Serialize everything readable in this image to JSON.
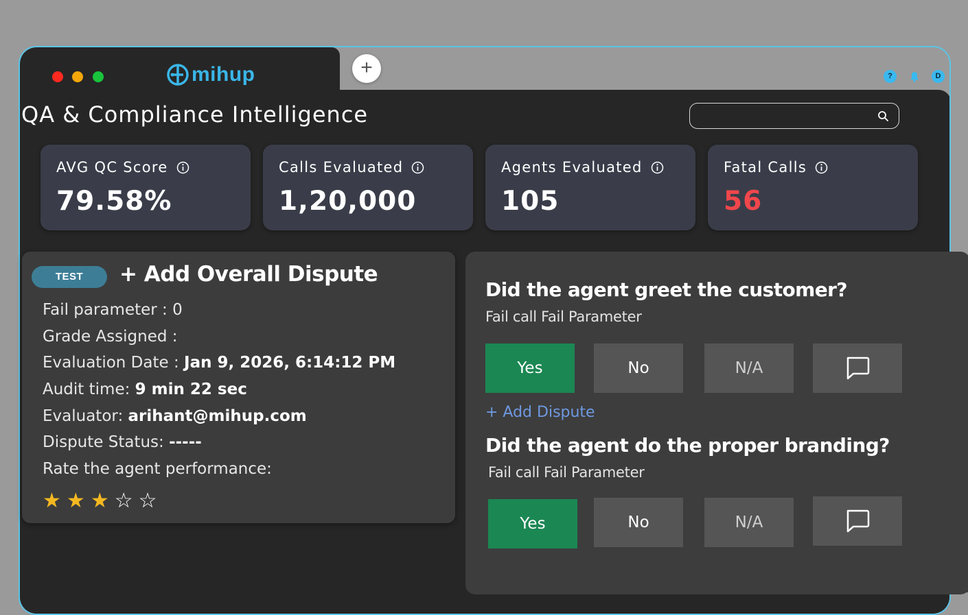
{
  "browser": {
    "brand": "mihup",
    "new_tab": "+"
  },
  "header": {
    "help": "?",
    "avatar": "D",
    "title": "QA & Compliance Intelligence",
    "search_placeholder": ""
  },
  "kpis": [
    {
      "label": "AVG QC Score",
      "value": "79.58%"
    },
    {
      "label": "Calls Evaluated",
      "value": "1,20,000"
    },
    {
      "label": "Agents Evaluated",
      "value": "105"
    },
    {
      "label": "Fatal Calls",
      "value": "56",
      "color": "#f0474c"
    }
  ],
  "evaluation": {
    "badge": "TEST",
    "add_overall": "+ Add Overall Dispute",
    "rows": [
      {
        "label": "Fail parameter : 0",
        "value": ""
      },
      {
        "label": "Grade Assigned :",
        "value": ""
      },
      {
        "label": "Evaluation Date : ",
        "value": "Jan 9, 2026, 6:14:12 PM"
      },
      {
        "label": "Audit time: ",
        "value": "9 min 22 sec"
      },
      {
        "label": "Evaluator: ",
        "value": "arihant@mihup.com"
      },
      {
        "label": "Dispute Status: ",
        "value": "-----"
      },
      {
        "label": "Rate the agent performance:",
        "value": ""
      }
    ],
    "rating": 3,
    "rating_max": 5
  },
  "questions": [
    {
      "title": "Did the agent greet the customer?",
      "sub": "Fail call Fail Parameter",
      "options": [
        "Yes",
        "No",
        "N/A"
      ],
      "selected": "Yes",
      "add_dispute": "+ Add Dispute"
    },
    {
      "title": "Did the agent do the proper branding?",
      "sub": "Fail call Fail Parameter",
      "options": [
        "Yes",
        "No",
        "N/A"
      ],
      "selected": "Yes"
    }
  ],
  "colors": {
    "accent": "#3ab6e8",
    "selected": "#1b8753",
    "danger": "#f0474c",
    "card": "#3a3d49"
  }
}
